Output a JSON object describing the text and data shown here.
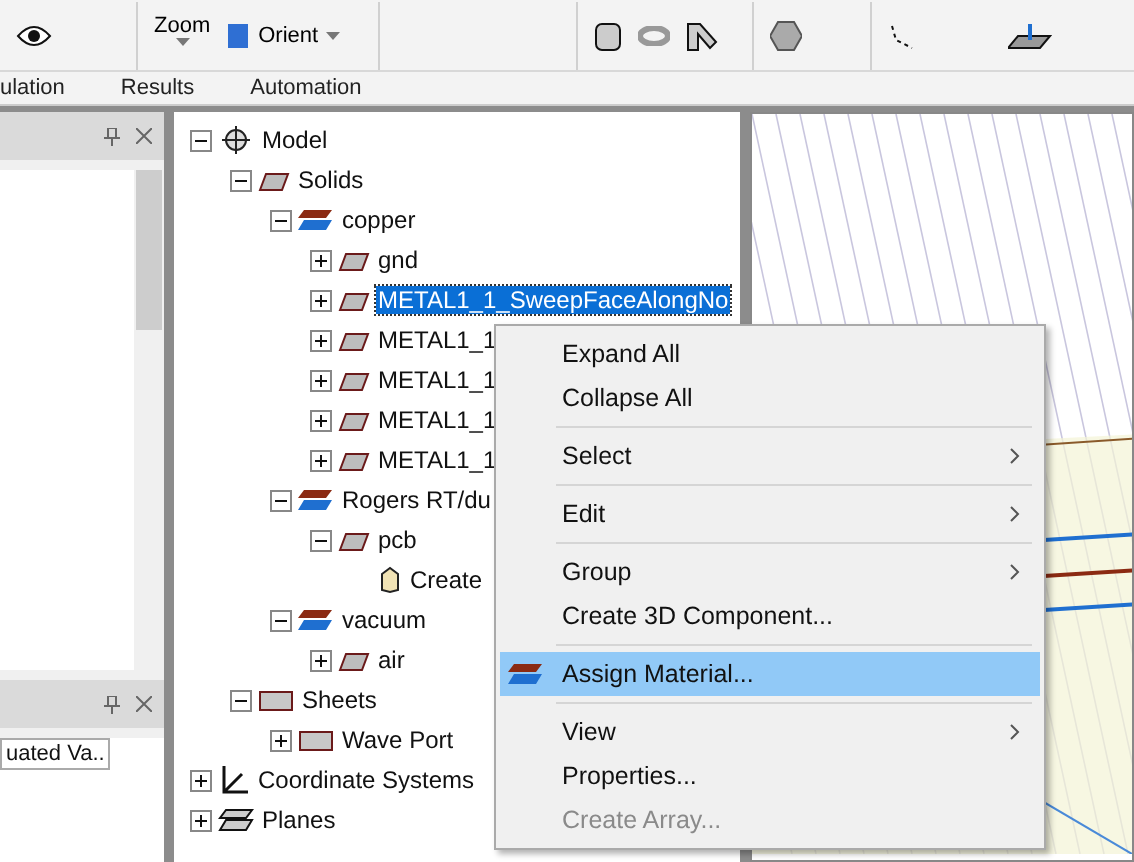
{
  "toolbar": {
    "zoom_label": "Zoom",
    "orient_label": "Orient"
  },
  "ribbon_tabs": [
    {
      "label": "ulation",
      "selected": false
    },
    {
      "label": "Results",
      "selected": false
    },
    {
      "label": "Automation",
      "selected": false
    }
  ],
  "properties_panel": {
    "column_header": "uated Va.."
  },
  "tree": [
    {
      "label": "Model",
      "kind": "model",
      "expanded": true,
      "selected": false,
      "children": [
        {
          "label": "Solids",
          "kind": "solid",
          "expanded": true,
          "selected": false,
          "children": [
            {
              "label": "copper",
              "kind": "material",
              "expanded": true,
              "selected": false,
              "children": [
                {
                  "label": "gnd",
                  "kind": "solid",
                  "expanded": false,
                  "selected": false
                },
                {
                  "label": "METAL1_1_SweepFaceAlongNo",
                  "kind": "solid",
                  "expanded": false,
                  "selected": true
                },
                {
                  "label": "METAL1_1",
                  "kind": "solid",
                  "expanded": false,
                  "selected": false
                },
                {
                  "label": "METAL1_1",
                  "kind": "solid",
                  "expanded": false,
                  "selected": false
                },
                {
                  "label": "METAL1_1",
                  "kind": "solid",
                  "expanded": false,
                  "selected": false
                },
                {
                  "label": "METAL1_1",
                  "kind": "solid",
                  "expanded": false,
                  "selected": false
                }
              ]
            },
            {
              "label": "Rogers RT/du",
              "kind": "material",
              "expanded": true,
              "selected": false,
              "children": [
                {
                  "label": "pcb",
                  "kind": "solid",
                  "expanded": true,
                  "selected": false,
                  "children": [
                    {
                      "label": "Create",
                      "kind": "operation",
                      "selected": false
                    }
                  ]
                }
              ]
            },
            {
              "label": "vacuum",
              "kind": "material",
              "expanded": true,
              "selected": false,
              "children": [
                {
                  "label": "air",
                  "kind": "solid",
                  "expanded": false,
                  "selected": false
                }
              ]
            }
          ]
        },
        {
          "label": "Sheets",
          "kind": "sheet",
          "expanded": true,
          "selected": false,
          "children": [
            {
              "label": "Wave Port",
              "kind": "sheet",
              "expanded": false,
              "selected": false
            }
          ]
        }
      ]
    },
    {
      "label": "Coordinate Systems",
      "kind": "coordsys",
      "expanded": false,
      "selected": false
    },
    {
      "label": "Planes",
      "kind": "planes",
      "expanded": false,
      "selected": false
    }
  ],
  "context_menu": {
    "groups": [
      [
        {
          "label": "Expand All",
          "kind": "plain",
          "submenu": false,
          "highlighted": false,
          "disabled": false
        },
        {
          "label": "Collapse All",
          "kind": "plain",
          "submenu": false,
          "highlighted": false,
          "disabled": false
        }
      ],
      [
        {
          "label": "Select",
          "kind": "plain",
          "submenu": true,
          "highlighted": false,
          "disabled": false
        }
      ],
      [
        {
          "label": "Edit",
          "kind": "plain",
          "submenu": true,
          "highlighted": false,
          "disabled": false
        }
      ],
      [
        {
          "label": "Group",
          "kind": "plain",
          "submenu": true,
          "highlighted": false,
          "disabled": false
        },
        {
          "label": "Create 3D Component...",
          "kind": "plain",
          "submenu": false,
          "highlighted": false,
          "disabled": false
        }
      ],
      [
        {
          "label": "Assign Material...",
          "kind": "material",
          "submenu": false,
          "highlighted": true,
          "disabled": false
        }
      ],
      [
        {
          "label": "View",
          "kind": "plain",
          "submenu": true,
          "highlighted": false,
          "disabled": false
        },
        {
          "label": "Properties...",
          "kind": "plain",
          "submenu": false,
          "highlighted": false,
          "disabled": false
        },
        {
          "label": "Create Array...",
          "kind": "plain",
          "submenu": false,
          "highlighted": false,
          "disabled": true
        }
      ]
    ]
  }
}
